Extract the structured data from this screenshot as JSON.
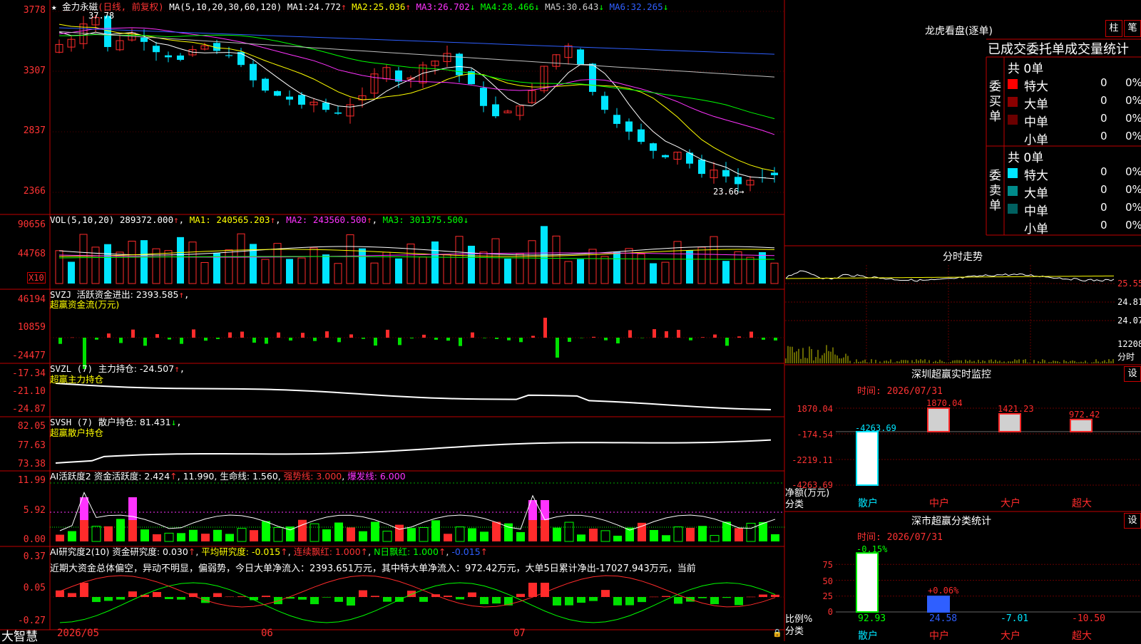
{
  "app": {
    "name": "大智慧"
  },
  "colors": {
    "up": "#ff2b2b",
    "down": "#00e5ff",
    "frame": "#c00000",
    "ma1": "#ffffff",
    "ma2": "#ffff00",
    "ma3": "#ff33ff",
    "ma4": "#00ff00",
    "ma5": "#c0c0c0",
    "ma6": "#2f5fff"
  },
  "main": {
    "stock": "金力永磁",
    "period": "(日线, 前复权)",
    "ma_params": "MA(5,10,20,30,60,120)",
    "ma": [
      {
        "label": "MA1:",
        "value": "24.772",
        "arrow": "↑"
      },
      {
        "label": "MA2:",
        "value": "25.036",
        "arrow": "↑"
      },
      {
        "label": "MA3:",
        "value": "26.702",
        "arrow": "↓"
      },
      {
        "label": "MA4:",
        "value": "28.466",
        "arrow": "↓"
      },
      {
        "label": "MA5:",
        "value": "30.643",
        "arrow": "↓"
      },
      {
        "label": "MA6:",
        "value": "32.265",
        "arrow": "↓"
      }
    ],
    "yaxis": [
      "3778",
      "3307",
      "2837",
      "2366"
    ],
    "high_mark": "37.78",
    "low_mark": "23.66"
  },
  "vol": {
    "title": "VOL(5,10,20)",
    "value": "289372.000",
    "ma1": "MA1: 240565.203",
    "ma2": "MA2: 243560.500",
    "ma3": "MA3: 301375.500",
    "yaxis": [
      "90656",
      "44768"
    ],
    "unit": "X10"
  },
  "svzj": {
    "title": "SVZJ",
    "line": "活跃资金进出: 2393.585",
    "sub": "超赢资金流(万元)",
    "yaxis": [
      "46194",
      "10859",
      "-24477"
    ]
  },
  "svzl": {
    "title": "SVZL (7)",
    "line": "主力持仓: -24.507",
    "sub": "超赢主力持仓",
    "yaxis": [
      "-17.34",
      "-21.10",
      "-24.87"
    ]
  },
  "svsh": {
    "title": "SVSH (7)",
    "line": "散户持仓: 81.431",
    "sub": "超赢散户持仓",
    "yaxis": [
      "82.05",
      "77.63",
      "73.38"
    ]
  },
  "ai2": {
    "title": "AI活跃度2",
    "a": "资金活跃度: 2.424",
    "b": "11.990",
    "c": "生命线: 1.560",
    "d": "强势线: 3.000",
    "e": "爆发线: 6.000",
    "yaxis": [
      "11.99",
      "5.92",
      "0.00"
    ]
  },
  "ai3": {
    "title": "AI研究度2(10)",
    "a": "资金研究度: 0.030",
    "b": "平均研究度: -0.015",
    "c": "连续飘红: 1.000",
    "d": "N日飘红: 1.000",
    "e": "-0.015",
    "comment": "近期大资金总体偏空，异动不明显，偏弱势，今日大单净流入：2393.651万元，其中特大单净流入：972.42万元，大单5日累计净出-17027.943万元，当前",
    "yaxis": [
      "0.37",
      "0.05",
      "-0.27"
    ]
  },
  "xaxis": [
    "2026/05",
    "06",
    "07"
  ],
  "lhb": {
    "title": "龙虎看盘(逐单)",
    "btn1": "柱",
    "btn2": "笔",
    "subtitle": "已成交委托单成交量统计",
    "buy_label": "委买单",
    "sell_label": "委卖单",
    "buy_total": "共 0单",
    "sell_total": "共 0单",
    "buy_rows": [
      {
        "name": "特大",
        "count": "0",
        "pct": "0%",
        "color": "#ff0000"
      },
      {
        "name": "大单",
        "count": "0",
        "pct": "0%",
        "color": "#8b0000"
      },
      {
        "name": "中单",
        "count": "0",
        "pct": "0%",
        "color": "#6b0000"
      },
      {
        "name": "小单",
        "count": "0",
        "pct": "0%",
        "color": "#000000"
      }
    ],
    "sell_rows": [
      {
        "name": "特大",
        "count": "0",
        "pct": "0%",
        "color": "#00e5ff"
      },
      {
        "name": "大单",
        "count": "0",
        "pct": "0%",
        "color": "#008b8b"
      },
      {
        "name": "中单",
        "count": "0",
        "pct": "0%",
        "color": "#006060"
      },
      {
        "name": "小单",
        "count": "0",
        "pct": "0%",
        "color": "#000000"
      }
    ]
  },
  "fenshi": {
    "title": "分时走势",
    "yaxis": [
      "25.55",
      "24.81",
      "24.07",
      "12208"
    ],
    "unit": "分时"
  },
  "monitor": {
    "title": "深圳超赢实时监控",
    "btn": "设",
    "time": "时间: 2026/07/31",
    "yaxis": [
      "1870.04",
      "-174.54",
      "-2219.11",
      "-4263.69"
    ],
    "ylabel": "净额(万元)",
    "xlabel": "分类",
    "chart_data": {
      "type": "bar",
      "categories": [
        "散户",
        "中户",
        "大户",
        "超大"
      ],
      "values": [
        -4263.69,
        1870.04,
        1421.23,
        972.42
      ],
      "ylim": [
        -4263.69,
        1870.04
      ],
      "ylabel": "净额(万元)"
    }
  },
  "classify": {
    "title": "深市超赢分类统计",
    "btn": "设",
    "time": "时间: 2026/07/31",
    "yaxis": [
      "75",
      "50",
      "25",
      "0"
    ],
    "ylabel": "比例%",
    "xlabel": "分类",
    "top_labels": [
      "-0.15%",
      "+0.06%"
    ],
    "bottom_values": [
      "92.93",
      "24.58",
      "-7.01",
      "-10.50"
    ],
    "chart_data": {
      "type": "bar",
      "categories": [
        "散户",
        "中户",
        "大户",
        "超大"
      ],
      "values": [
        92.93,
        24.58,
        -7.01,
        -10.5
      ],
      "ylim": [
        0,
        100
      ],
      "ylabel": "比例%"
    }
  }
}
